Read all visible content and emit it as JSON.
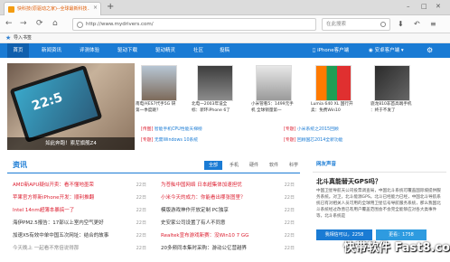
{
  "browser": {
    "tab_title": "快科技(原驱动之家)--全球最新科技…",
    "tab_close": "×",
    "new_tab": "+",
    "url": "http://www.mydrivers.com/",
    "search_placeholder": "在此搜索",
    "bookmark_label": "导入书签"
  },
  "nav": {
    "items": [
      "首页",
      "新闻资讯",
      "评测体验",
      "驱动下载",
      "驱动精灵",
      "社区",
      "投稿"
    ],
    "right": [
      "iPhone客户端",
      "安卓客户端"
    ]
  },
  "hero": {
    "caption": "如此奔跑！索尼旗舰Z4",
    "time": "22:5"
  },
  "thumbs": [
    {
      "caption": "南电兴ES7代手5G 研第一季度跳？"
    },
    {
      "caption": "北电一2003年设全 标：新环iPhone 6了"
    },
    {
      "caption": "小米管看5：1499元手机 全球销量第一"
    },
    {
      "caption": "Lumia 640 XL 国行开卖：免费Win10"
    },
    {
      "caption": "骁龙810非首高端手机 ：终于不发了"
    }
  ],
  "small_news": [
    {
      "tag": "[传图]",
      "text": "智能手机CPU性能天梯榜"
    },
    {
      "tag": "[专题]",
      "text": "小米系统之2015回顾"
    },
    {
      "tag": "[专题]",
      "text": "无需Windows 10系统"
    },
    {
      "tag": "[专题]",
      "text": "回顾国芯2014全新功能"
    }
  ],
  "section": {
    "title": "资讯",
    "tabs": [
      "全部",
      "手机",
      "硬件",
      "软件",
      "科学"
    ]
  },
  "news_left": [
    {
      "title": "AMD新APU疑似开卖：看不懂地墨荣",
      "date": "22日",
      "color": "#d23"
    },
    {
      "title": "苹果官方称新iPhone开发：顺利推翻",
      "date": "22日",
      "color": "#d23"
    },
    {
      "title": "Intel 14nm超薄本暴搞一了",
      "date": "22日",
      "color": "#d23"
    },
    {
      "title": "海伊PM2.5报告：17部以上室内空气更好",
      "date": "22日",
      "color": "#333"
    },
    {
      "title": "加速X5有效中单中国五次网址：结合的故事",
      "date": "22日",
      "color": "#333"
    },
    {
      "title": "今天晚上 一起看不常倍说得那",
      "date": "22日",
      "color": "#333"
    }
  ],
  "news_right": [
    {
      "title": "为苍舢中国网络 日本超集体加速担忧",
      "date": "22日",
      "color": "#d23"
    },
    {
      "title": "小米今天的成力：你能看出哪张图里？",
      "date": "22日",
      "color": "#d23"
    },
    {
      "title": "模版游戏神作开放定制 PC独享",
      "date": "22日",
      "color": "#333"
    },
    {
      "title": "史安家公司设置了有人不同意",
      "date": "22日",
      "color": "#333"
    },
    {
      "title": "Realtek宣布游戏新赛：没Win10 7 GG",
      "date": "22日",
      "color": "#d23"
    },
    {
      "title": "20多频同本集时采购：游动公亿营越界",
      "date": "22日",
      "color": "#333"
    }
  ],
  "right_panel": {
    "title": "网友声音",
    "question": "北斗真能替天GPS吗？",
    "body": "中国卫星导航天公司投票调查局，中国北斗系统可覆盖国际坡提供服务系统。对卫，北斗能源GPS。北斗已经能力已经，中国北斗导航系统已有对相关人员可用的全球用卫星信号导航服务系统，那么我国北斗系统经过改善已有用户覆盖范围会不会完全能够应对各大类事件等，北斗系统是",
    "vote_yes": "我相信可以，2258",
    "vote_more": "更看：1758"
  },
  "watermark": "快带软件 Fast8.com"
}
